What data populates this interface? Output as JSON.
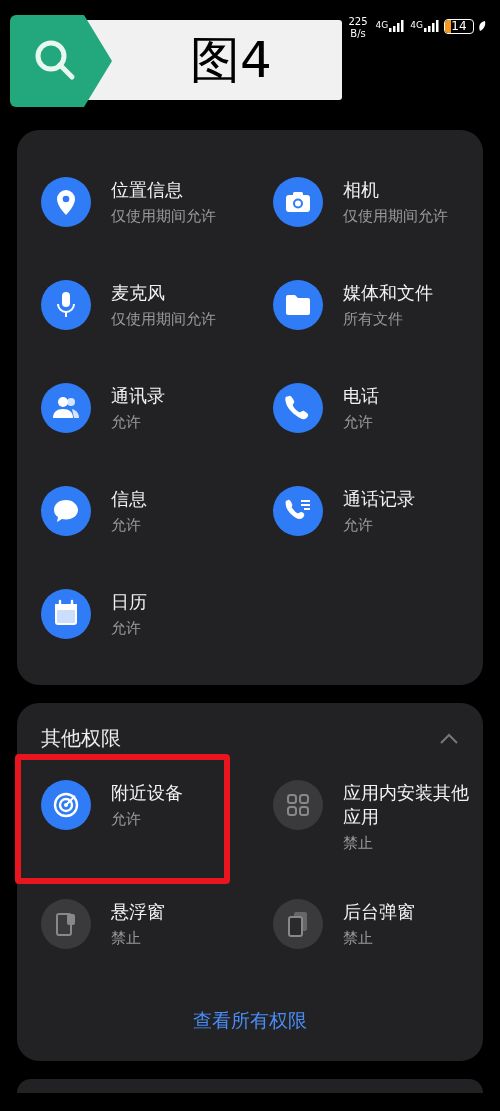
{
  "status_bar": {
    "speed_value": "225",
    "speed_unit": "B/s",
    "networks": [
      "4G",
      "4G"
    ],
    "battery": "14"
  },
  "figure_label": {
    "text": "图4"
  },
  "permission_cards": [
    {
      "items": [
        {
          "title": "位置信息",
          "status": "仅使用期间允许",
          "allowed": true,
          "highlighted": false
        },
        {
          "title": "相机",
          "status": "仅使用期间允许",
          "allowed": true,
          "highlighted": false
        },
        {
          "title": "麦克风",
          "status": "仅使用期间允许",
          "allowed": true,
          "highlighted": false
        },
        {
          "title": "媒体和文件",
          "status": "所有文件",
          "allowed": true,
          "highlighted": false
        },
        {
          "title": "通讯录",
          "status": "允许",
          "allowed": true,
          "highlighted": false
        },
        {
          "title": "电话",
          "status": "允许",
          "allowed": true,
          "highlighted": false
        },
        {
          "title": "信息",
          "status": "允许",
          "allowed": true,
          "highlighted": false
        },
        {
          "title": "通话记录",
          "status": "允许",
          "allowed": true,
          "highlighted": false
        },
        {
          "title": "日历",
          "status": "允许",
          "allowed": true,
          "highlighted": false
        }
      ]
    },
    {
      "title": "其他权限",
      "expanded": true,
      "items": [
        {
          "title": "附近设备",
          "status": "允许",
          "allowed": true,
          "highlighted": true
        },
        {
          "title": "应用内安装其他应用",
          "status": "禁止",
          "allowed": false,
          "highlighted": false
        },
        {
          "title": "悬浮窗",
          "status": "禁止",
          "allowed": false,
          "highlighted": false
        },
        {
          "title": "后台弹窗",
          "status": "禁止",
          "allowed": false,
          "highlighted": false
        }
      ],
      "link": "查看所有权限"
    }
  ]
}
